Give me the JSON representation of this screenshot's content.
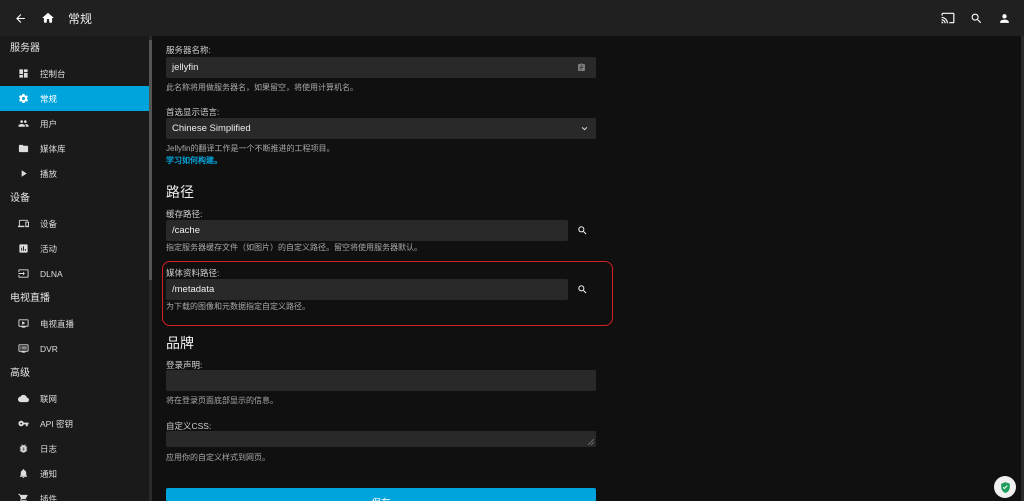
{
  "header": {
    "title": "常规"
  },
  "sidebar": {
    "sections": [
      {
        "title": "服务器",
        "items": [
          {
            "label": "控制台",
            "icon": "dashboard-icon"
          },
          {
            "label": "常规",
            "icon": "gear-icon",
            "active": true
          },
          {
            "label": "用户",
            "icon": "users-icon"
          },
          {
            "label": "媒体库",
            "icon": "folder-icon"
          },
          {
            "label": "播放",
            "icon": "play-icon"
          }
        ]
      },
      {
        "title": "设备",
        "items": [
          {
            "label": "设备",
            "icon": "devices-icon"
          },
          {
            "label": "活动",
            "icon": "activity-icon"
          },
          {
            "label": "DLNA",
            "icon": "input-icon"
          }
        ]
      },
      {
        "title": "电视直播",
        "items": [
          {
            "label": "电视直播",
            "icon": "live-tv-icon"
          },
          {
            "label": "DVR",
            "icon": "dvr-icon"
          }
        ]
      },
      {
        "title": "高级",
        "items": [
          {
            "label": "联网",
            "icon": "cloud-icon"
          },
          {
            "label": "API 密钥",
            "icon": "key-icon"
          },
          {
            "label": "日志",
            "icon": "bug-icon"
          },
          {
            "label": "通知",
            "icon": "bell-icon"
          },
          {
            "label": "插件",
            "icon": "cart-icon"
          }
        ]
      }
    ]
  },
  "form": {
    "server_name": {
      "label": "服务器名称:",
      "value": "jellyfin",
      "help": "此名称将用做服务器名，如果留空，将使用计算机名。"
    },
    "language": {
      "label": "首选显示语言:",
      "value": "Chinese Simplified",
      "help": "Jellyfin的翻译工作是一个不断推进的工程项目。",
      "link": "学习如何构建。"
    },
    "paths": {
      "heading": "路径",
      "cache": {
        "label": "缓存路径:",
        "value": "/cache",
        "help": "指定服务器缓存文件（如图片）的自定义路径。留空将使用服务器默认。"
      },
      "metadata": {
        "label": "媒体资料路径:",
        "value": "/metadata",
        "help": "为下载的图像和元数据指定自定义路径。"
      }
    },
    "branding": {
      "heading": "品牌",
      "login_disclaimer": {
        "label": "登录声明:",
        "value": "",
        "help": "将在登录页面底部显示的信息。"
      },
      "custom_css": {
        "label": "自定义CSS:",
        "value": "",
        "help": "应用你的自定义样式到网页。"
      }
    },
    "save_label": "保存"
  },
  "colors": {
    "accent": "#00a4dc",
    "highlight": "#d91f26",
    "background": "#101010"
  }
}
